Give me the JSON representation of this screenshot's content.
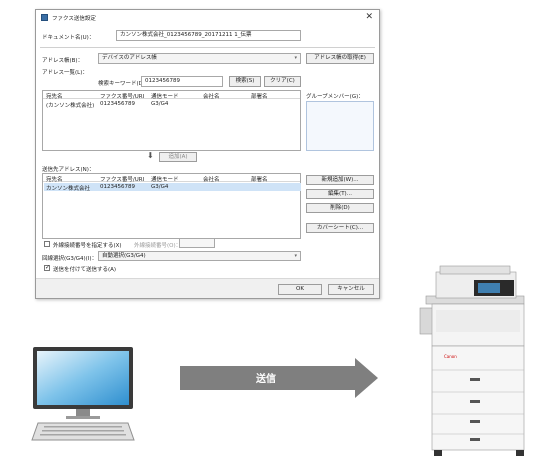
{
  "dialog": {
    "title": "ファクス送信設定",
    "document_name_label": "ドキュメント名(U)：",
    "document_name_value": "カンソン株式会社_0123456789_20171211 1_伝票",
    "address_book_label": "アドレス帳(B)：",
    "address_book_value": "デバイスのアドレス帳",
    "get_address_book_button": "アドレス帳の取得(E)",
    "address_list_label": "アドレス一覧(L)：",
    "search_keyword_label": "検索キーワード(D)：",
    "search_keyword_value": "0123456789",
    "search_button": "検索(S)",
    "clear_button": "クリア(C)",
    "group_member_label": "グループメンバー(G)：",
    "columns": [
      "宛先名",
      "ファクス番号/URI",
      "通信モード",
      "会社名",
      "部署名"
    ],
    "address_rows": [
      {
        "name": "(カンソン株式会社)",
        "fax": "0123456789",
        "mode": "G3/G4",
        "company": "",
        "dept": ""
      }
    ],
    "add_button": "追加(A)",
    "destination_label": "送信先アドレス(N)：",
    "destination_rows": [
      {
        "name": "カンソン株式会社",
        "fax": "0123456789",
        "mode": "G3/G4",
        "company": "",
        "dept": ""
      }
    ],
    "new_register_button": "新規追加(W)...",
    "edit_button": "編集(T)...",
    "delete_button": "削除(D)",
    "cover_sheet_button": "カバーシート(C)...",
    "outside_line_checkbox": "外線接続番号を指定する(X)",
    "outside_line_label": "外線接続番号(O)：",
    "line_select_label": "回線選択(G3/G4)(I)：",
    "line_select_value": "自動選択(G3/G4)",
    "log_checkbox": "送信を付けて送信する(A)",
    "ok_button": "OK",
    "cancel_button": "キャンセル"
  },
  "arrow": {
    "label": "送信"
  },
  "printer": {
    "brand": "Canon"
  }
}
